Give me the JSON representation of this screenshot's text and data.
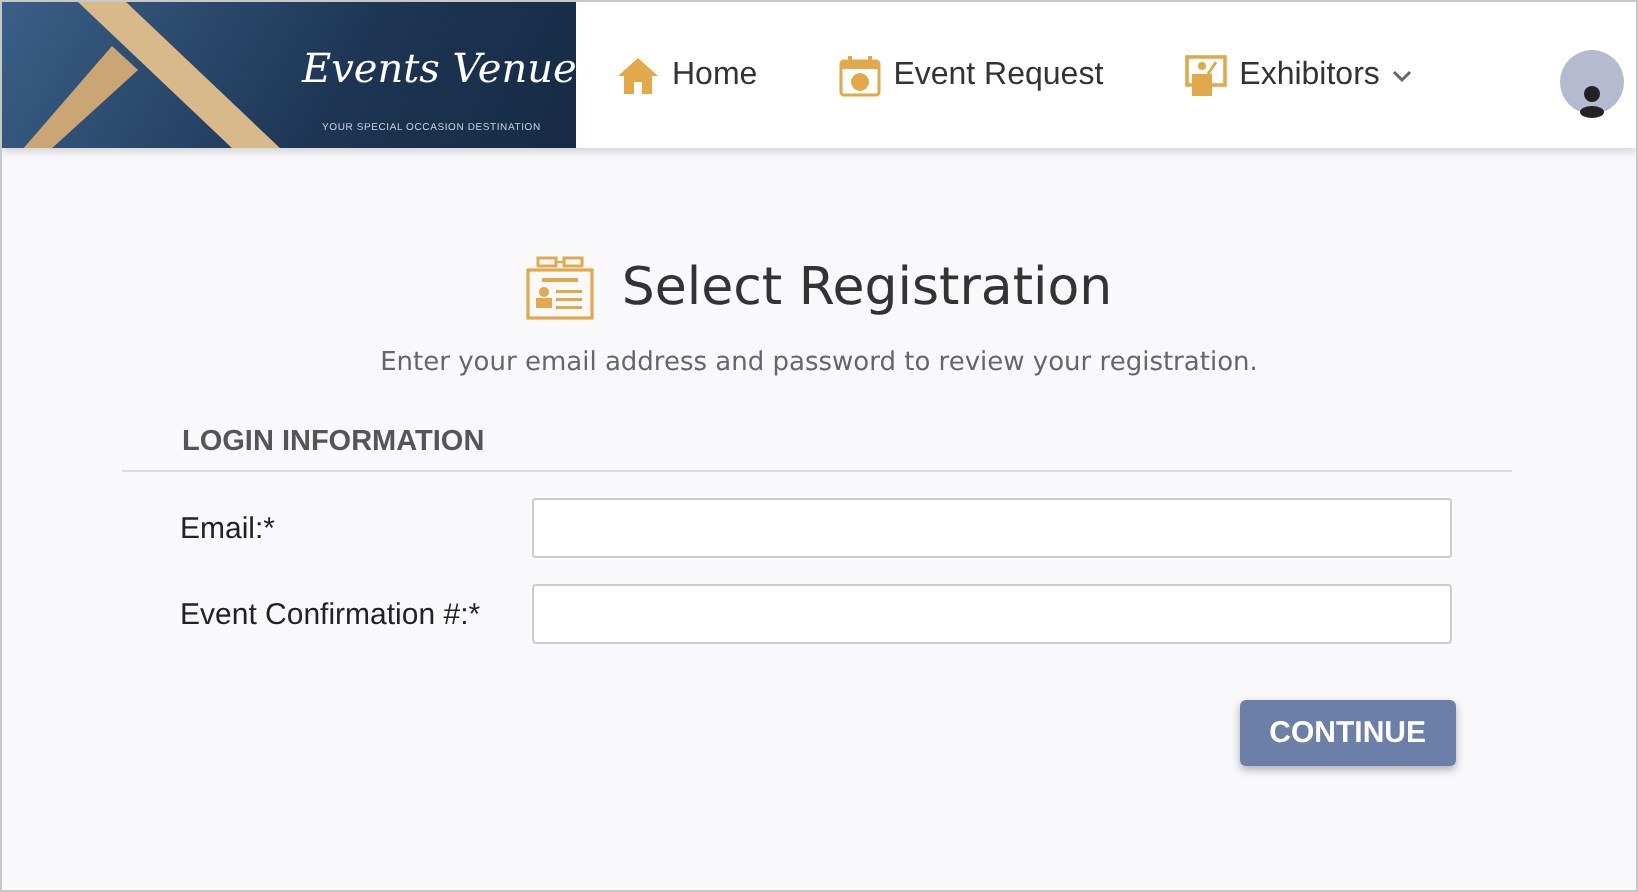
{
  "logo": {
    "name": "Events Venue",
    "tagline": "YOUR SPECIAL OCCASION DESTINATION"
  },
  "nav": [
    {
      "label": "Home",
      "kind": "home",
      "dropdown": false
    },
    {
      "label": "Event Request",
      "kind": "request",
      "dropdown": false
    },
    {
      "label": "Exhibitors",
      "kind": "exhibitors",
      "dropdown": true
    }
  ],
  "page": {
    "title": "Select Registration",
    "subtitle": "Enter your email address and password to review your registration."
  },
  "section": {
    "heading": "LOGIN INFORMATION"
  },
  "fields": [
    {
      "label": "Email:",
      "required_mark": "*"
    },
    {
      "label": "Event Confirmation #:",
      "required_mark": "*"
    }
  ],
  "buttons": [
    {
      "label": "CONTINUE"
    }
  ]
}
